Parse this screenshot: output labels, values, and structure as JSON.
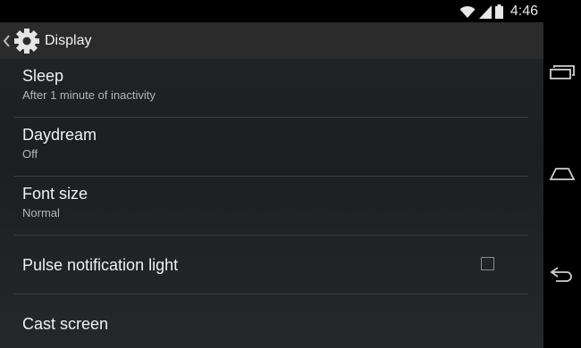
{
  "status_bar": {
    "time": "4:46",
    "icons": [
      "wifi-icon",
      "cell-signal-icon",
      "battery-icon"
    ]
  },
  "action_bar": {
    "title": "Display",
    "icons": [
      "back-chevron-icon",
      "settings-gear-icon"
    ]
  },
  "settings": [
    {
      "title": "Sleep",
      "summary": "After 1 minute of inactivity"
    },
    {
      "title": "Daydream",
      "summary": "Off"
    },
    {
      "title": "Font size",
      "summary": "Normal"
    },
    {
      "title": "Pulse notification light",
      "checkbox": false
    },
    {
      "title": "Cast screen"
    }
  ],
  "nav_bar": {
    "buttons": [
      "recent-apps-icon",
      "home-icon",
      "back-icon"
    ]
  },
  "colors": {
    "background": "#202224",
    "action_bar": "#2b2b2b",
    "divider": "#3a3c3e",
    "text_primary": "#f0f0f0",
    "text_secondary": "#b5b5b5"
  }
}
